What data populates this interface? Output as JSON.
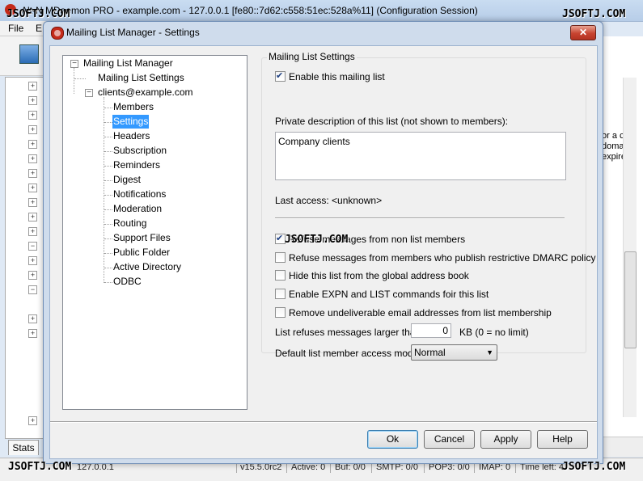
{
  "app": {
    "title": "Alt-N MDaemon PRO - example.com - 127.0.0.1 [fe80::7d62:c558:51ec:528a%11] (Configuration Session)",
    "menu": [
      "File",
      "E"
    ],
    "right_text": [
      "or a c",
      "doma",
      "expire"
    ],
    "stats_tab": "Stats",
    "status": {
      "ip": "127.0.0.1",
      "version": "v15.5.0rc2",
      "active": "Active: 0",
      "buf": "Buf: 0/0",
      "smtp": "SMTP: 0/0",
      "pop3": "POP3: 0/0",
      "imap": "IMAP: 0",
      "time_left": "Time left: 4"
    },
    "watermark": "JSOFTJ.COM"
  },
  "dialog": {
    "title": "Mailing List Manager - Settings",
    "close_glyph": "✕",
    "tree": {
      "root": "Mailing List Manager",
      "list_settings": "Mailing List Settings",
      "list_name": "clients@example.com",
      "children": [
        "Members",
        "Settings",
        "Headers",
        "Subscription",
        "Reminders",
        "Digest",
        "Notifications",
        "Moderation",
        "Routing",
        "Support Files",
        "Public Folder",
        "Active Directory",
        "ODBC"
      ],
      "selected": "Settings"
    },
    "settings": {
      "group_title": "Mailing List Settings",
      "enable_label": "Enable this mailing list",
      "enable_checked": true,
      "description_label": "Private description of this list (not shown to members):",
      "description_value": "Company clients",
      "last_access": "Last access: <unknown>",
      "options": [
        {
          "label": "Refuse messages from non list members",
          "checked": true
        },
        {
          "label": "Refuse messages from members who publish restrictive DMARC policy",
          "checked": false
        },
        {
          "label": "Hide this list from the global address book",
          "checked": false
        },
        {
          "label": "Enable EXPN and LIST commands foir this list",
          "checked": false
        },
        {
          "label": "Remove undeliverable email addresses from list membership",
          "checked": false
        }
      ],
      "size_label": "List refuses messages larger than",
      "size_value": "0",
      "size_unit": "KB (0 = no limit)",
      "access_mode_label": "Default list member access mode",
      "access_mode_value": "Normal"
    },
    "buttons": {
      "ok": "Ok",
      "cancel": "Cancel",
      "apply": "Apply",
      "help": "Help"
    }
  }
}
